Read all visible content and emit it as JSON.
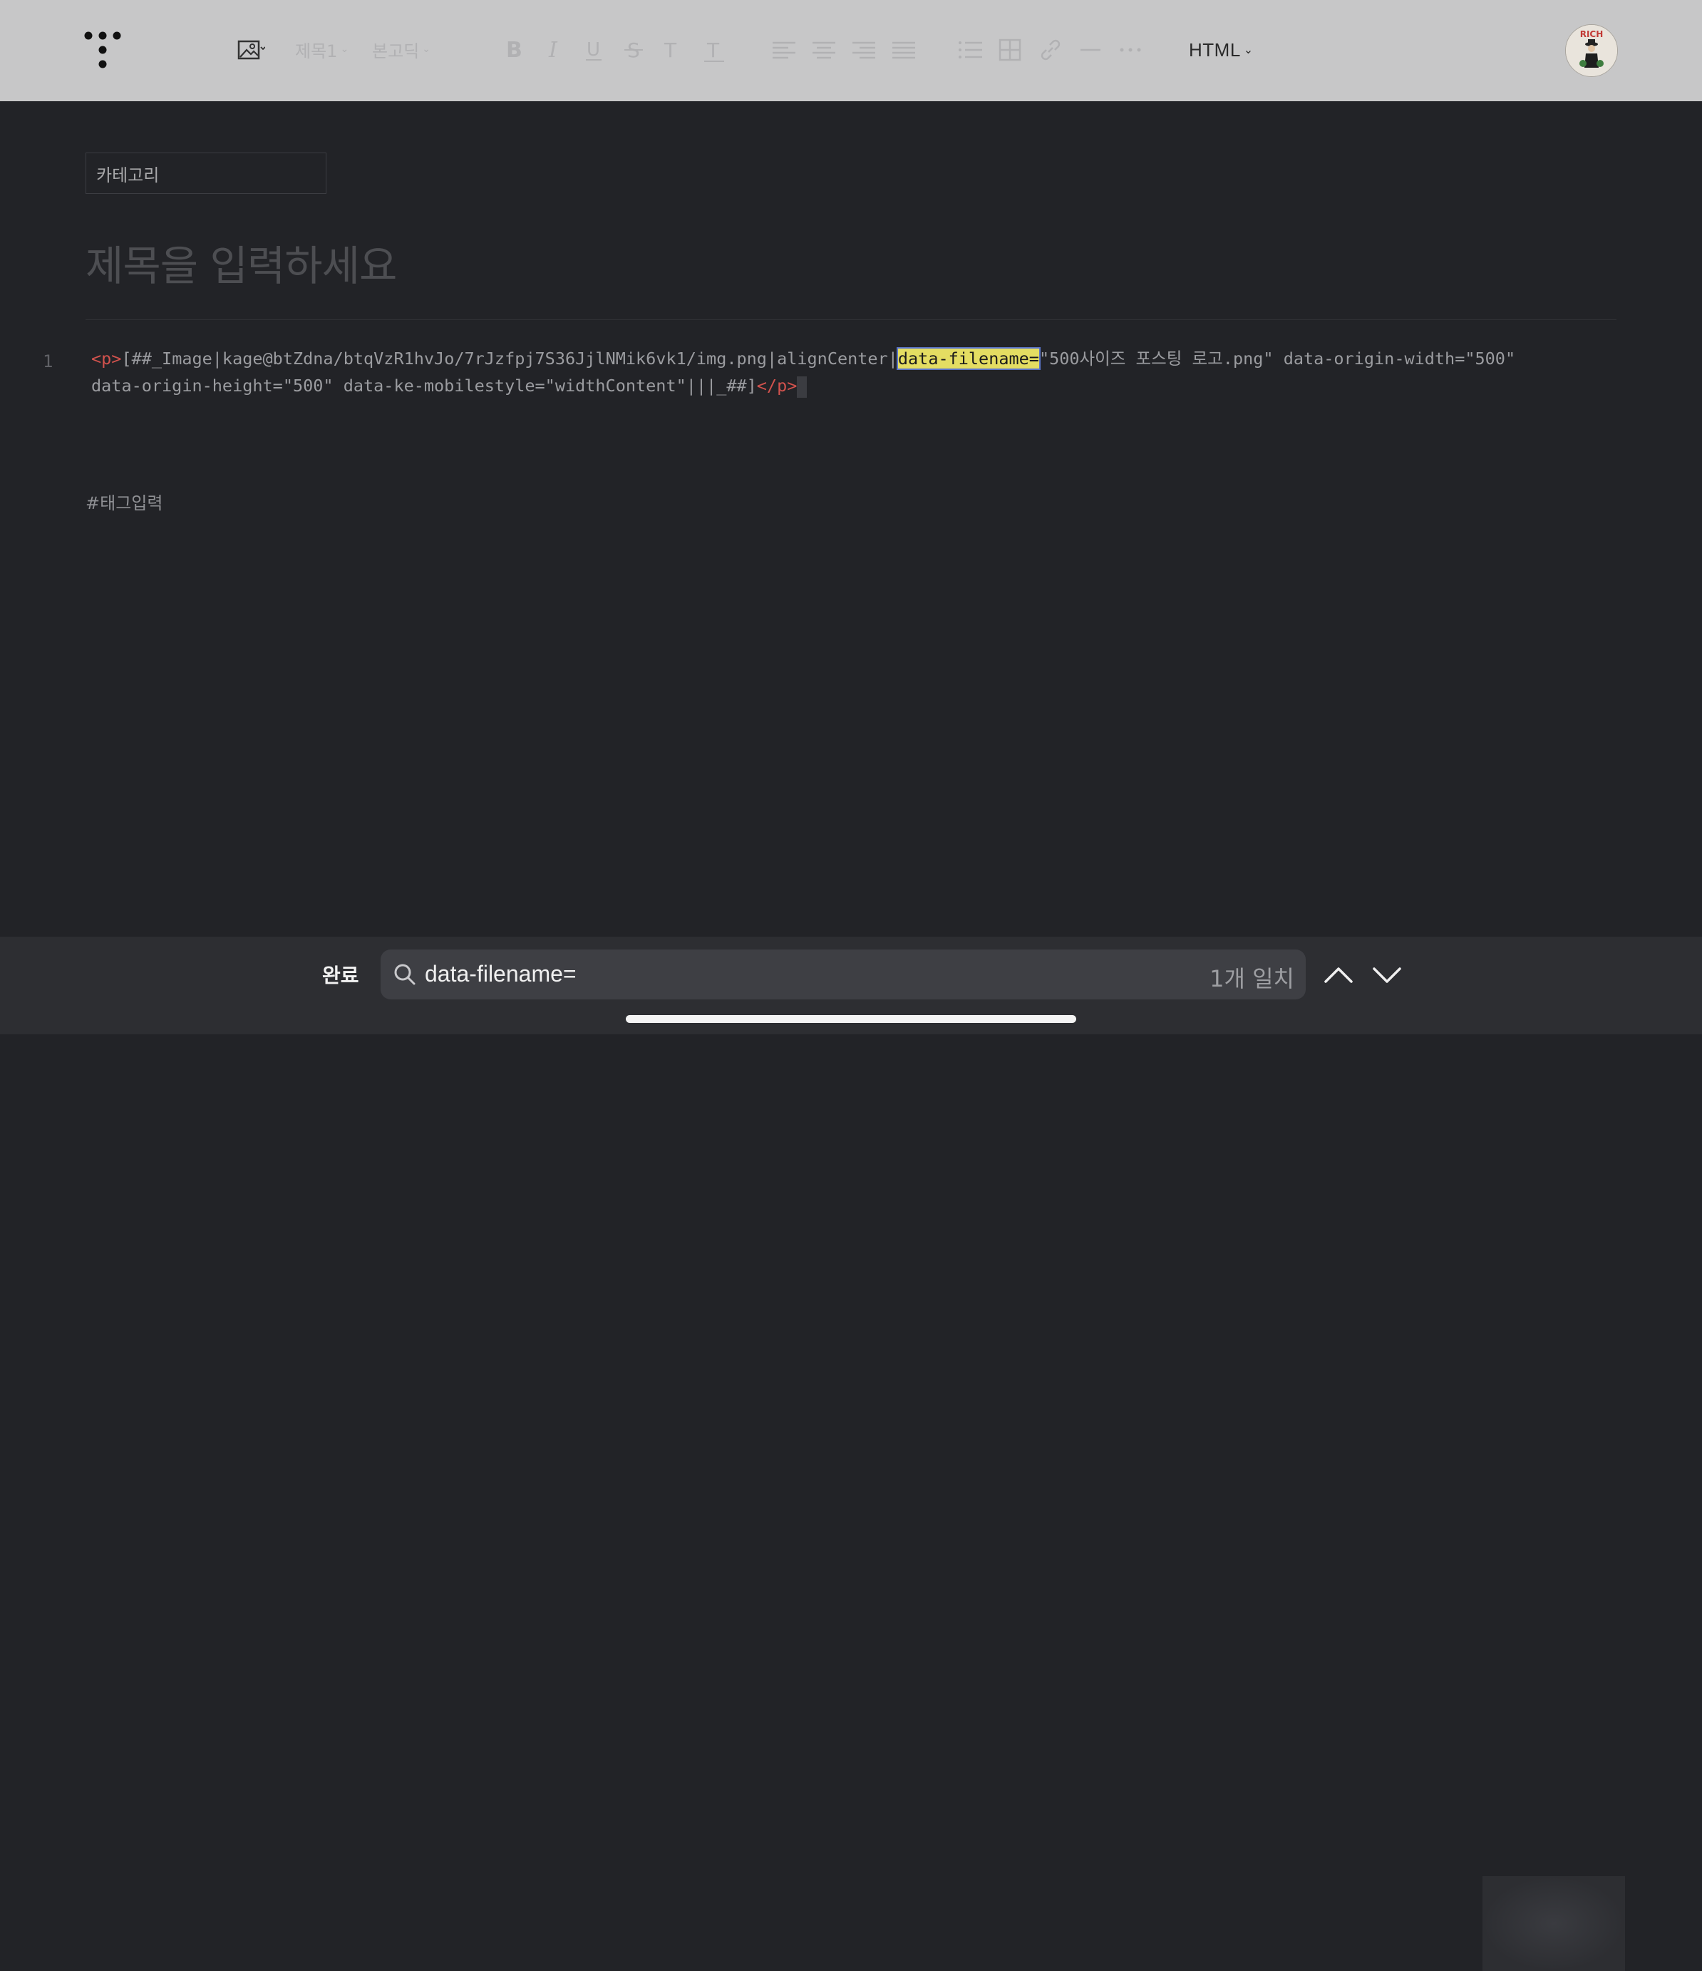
{
  "toolbar": {
    "heading_select": "제목1",
    "font_select": "본고딕",
    "mode_label": "HTML",
    "avatar_text": "RICH"
  },
  "editor": {
    "category_placeholder": "카테고리",
    "title_placeholder": "제목을 입력하세요",
    "line_number": "1",
    "code": {
      "tag_open": "<p>",
      "segment1": "[##_Image|kage@btZdna/btqVzR1hvJo/7rJzfpj7S36JjlNMik6vk1/img.png|alignCenter|",
      "highlight": "data-filename=",
      "segment2": "\"500사이즈 포스팅 로고.png\" data-origin-width=\"500\"",
      "line2": "data-origin-height=\"500\" data-ke-mobilestyle=\"widthContent\"|||_##]",
      "tag_close": "</p>"
    },
    "tags_placeholder": "#태그입력"
  },
  "findbar": {
    "done_label": "완료",
    "query": "data-filename=",
    "match_count": "1개 일치"
  },
  "colors": {
    "background": "#222327",
    "toolbar": "#c7c7c8",
    "highlight": "#e4dd62",
    "tag": "#d2524d"
  }
}
